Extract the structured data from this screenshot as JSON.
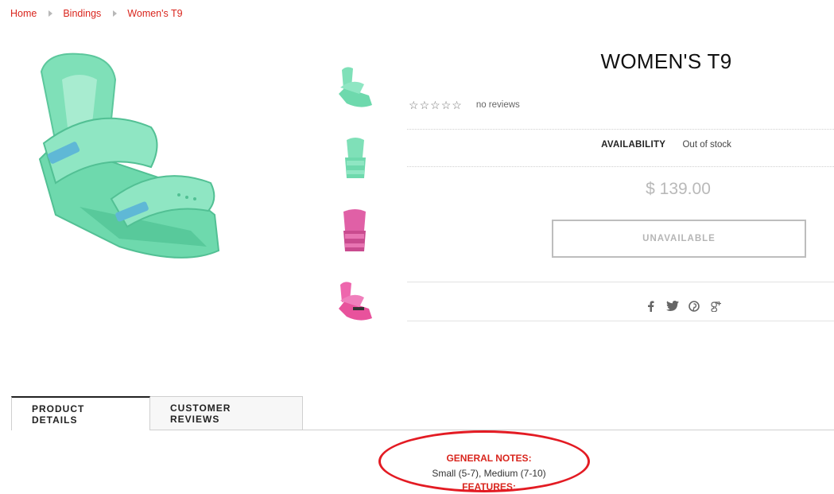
{
  "breadcrumb": {
    "home": "Home",
    "category": "Bindings",
    "current": "Women's T9"
  },
  "product": {
    "title": "WOMEN'S T9",
    "stars": [
      "☆",
      "☆",
      "☆",
      "☆",
      "☆"
    ],
    "reviews_text": "no reviews",
    "availability_label": "AVAILABILITY",
    "availability_value": "Out of stock",
    "price": "$ 139.00",
    "button_label": "UNAVAILABLE"
  },
  "thumbnails": [
    {
      "color": "mint"
    },
    {
      "color": "mint"
    },
    {
      "color": "pink"
    },
    {
      "color": "pink"
    }
  ],
  "share_icons": [
    "facebook-icon",
    "twitter-icon",
    "pinterest-icon",
    "google-plus-icon"
  ],
  "tabs": [
    "PRODUCT DETAILS",
    "CUSTOMER REVIEWS"
  ],
  "details": {
    "notes_heading": "GENERAL NOTES:",
    "notes_text": "Small (5-7), Medium (7-10)",
    "features_heading": "FEATURES:"
  },
  "colors": {
    "accent": "#d9251d",
    "mint": "#6ed9ad",
    "pink": "#e8529c",
    "highlight": "#e31b23"
  }
}
